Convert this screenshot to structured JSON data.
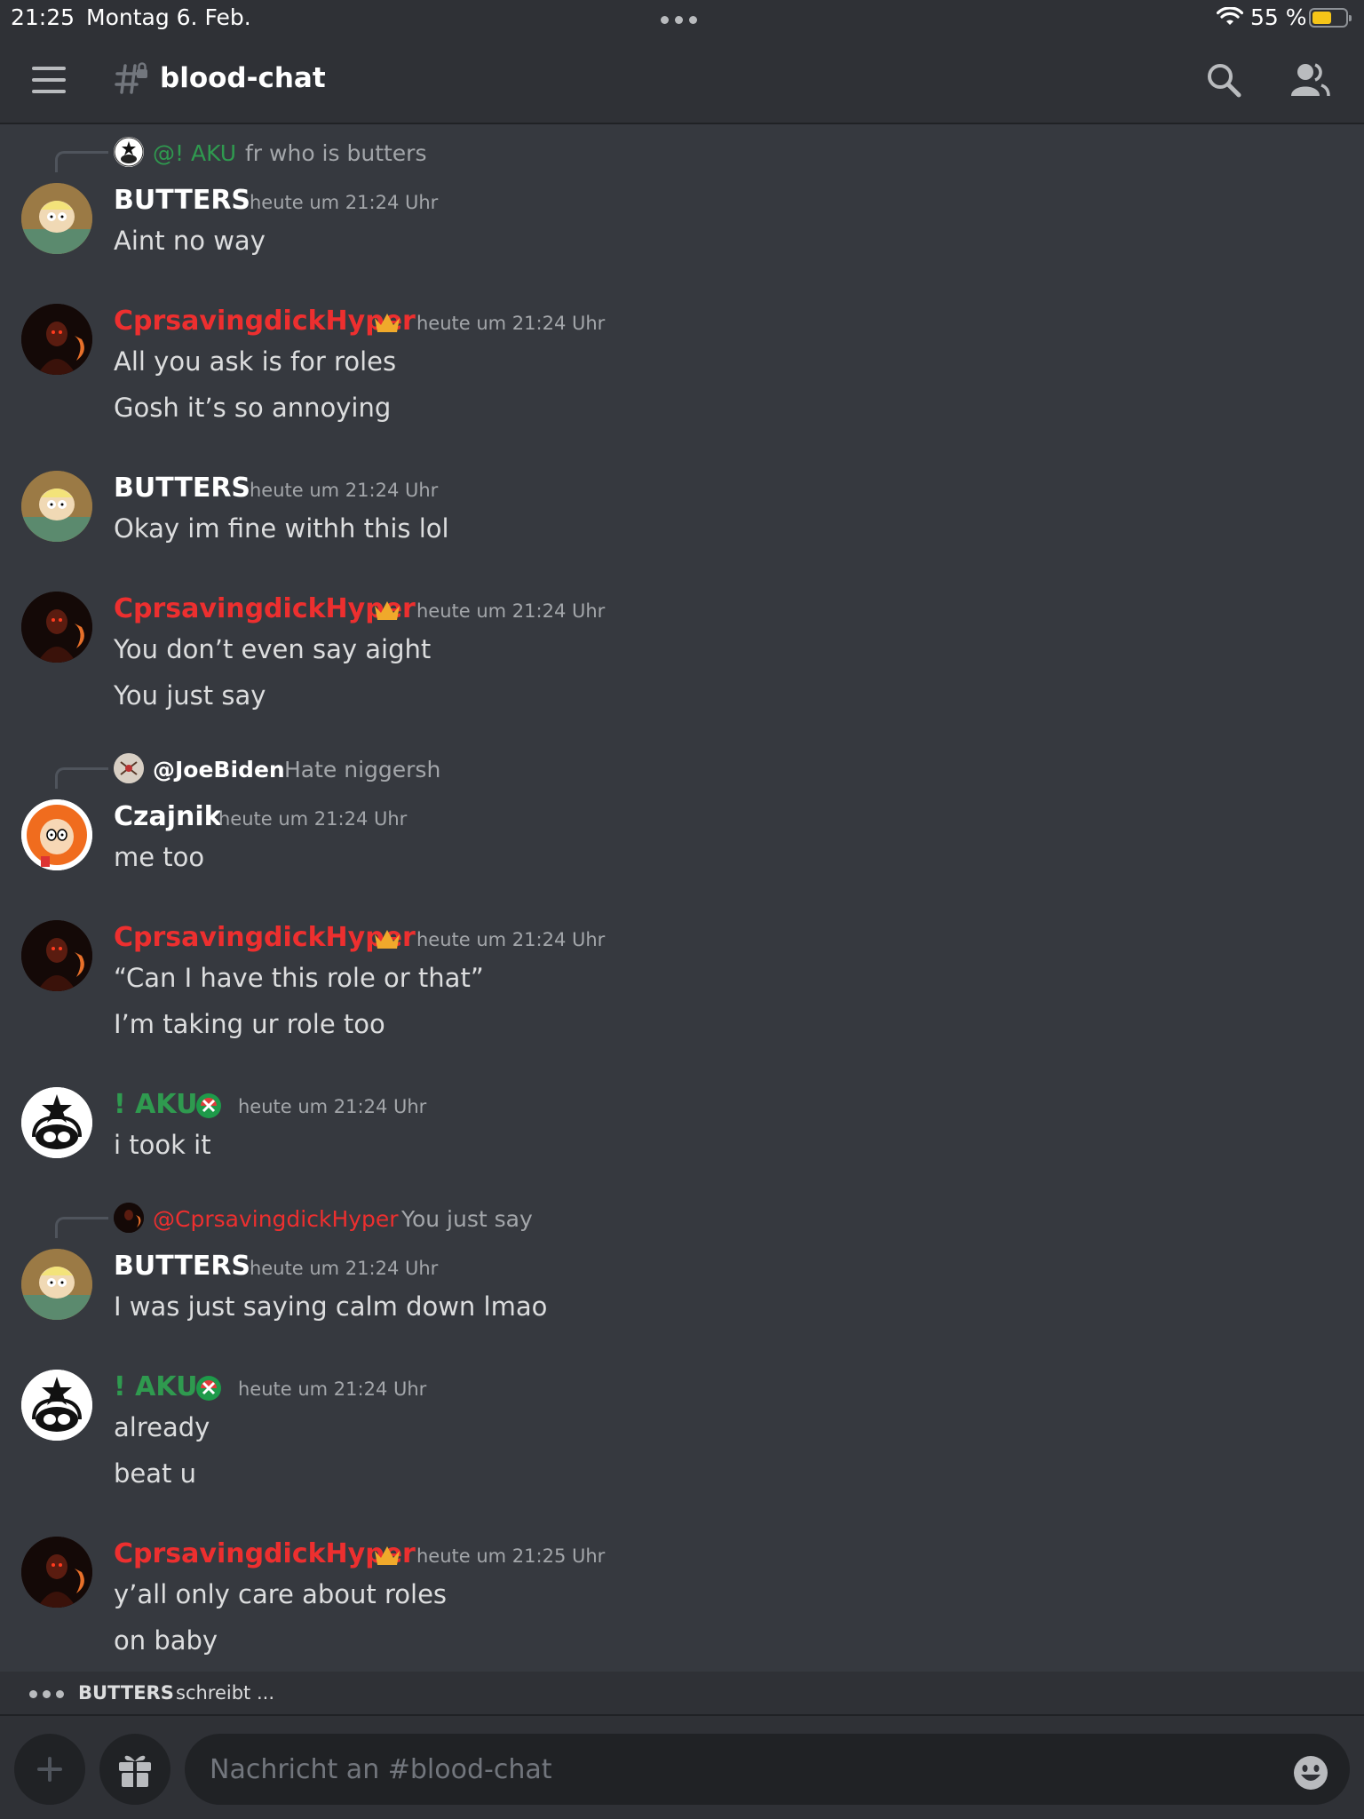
{
  "status": {
    "time": "21:25",
    "date": "Montag 6. Feb.",
    "battery": "55 %",
    "battery_level": 0.55
  },
  "header": {
    "channel": "blood-chat"
  },
  "colors": {
    "red": "#ed2f2f",
    "green": "#2f9a4f",
    "white": "#ffffff",
    "crown": "#f0a92b"
  },
  "messages": [
    {
      "reply": {
        "name": "@! AKU",
        "text": "fr who is butters"
      },
      "user": "BUTTERS",
      "time": "heute um 21:24 Uhr",
      "lines": [
        "Aint no way"
      ]
    },
    {
      "user": "CprsavingdickHyper",
      "time": "heute um 21:24 Uhr",
      "lines": [
        "All you ask is for roles",
        "Gosh it’s so annoying"
      ]
    },
    {
      "user": "BUTTERS",
      "time": "heute um 21:24 Uhr",
      "lines": [
        "Okay im fine withh this lol"
      ]
    },
    {
      "user": "CprsavingdickHyper",
      "time": "heute um 21:24 Uhr",
      "lines": [
        "You don’t even say aight",
        "You just say"
      ]
    },
    {
      "reply": {
        "name": "@JoeBiden",
        "text": "Hate niggersh"
      },
      "user": "Czajnik",
      "time": "heute um 21:24 Uhr",
      "lines": [
        "me too"
      ]
    },
    {
      "user": "CprsavingdickHyper",
      "time": "heute um 21:24 Uhr",
      "lines": [
        "“Can I have this role or that”",
        "I’m taking ur role too"
      ]
    },
    {
      "user": "! AKU",
      "time": "heute um 21:24 Uhr",
      "lines": [
        "i took it"
      ]
    },
    {
      "reply": {
        "name": "@CprsavingdickHyper",
        "text": "You just say"
      },
      "user": "BUTTERS",
      "time": "heute um 21:24 Uhr",
      "lines": [
        "I was just saying calm down lmao"
      ]
    },
    {
      "user": "! AKU",
      "time": "heute um 21:24 Uhr",
      "lines": [
        "already",
        "beat u"
      ]
    },
    {
      "user": "CprsavingdickHyper",
      "time": "heute um 21:25 Uhr",
      "lines": [
        "y’all only care about roles",
        "on baby"
      ]
    }
  ],
  "typing": {
    "name": "BUTTERS",
    "suffix": "schreibt ..."
  },
  "composer": {
    "placeholder": "Nachricht an #blood-chat"
  },
  "icons": [
    "menu-icon",
    "locked-channel-icon",
    "search-icon",
    "members-icon",
    "crown-icon",
    "role-badge-icon",
    "plus-icon",
    "gift-icon",
    "emoji-icon",
    "wifi-icon"
  ]
}
